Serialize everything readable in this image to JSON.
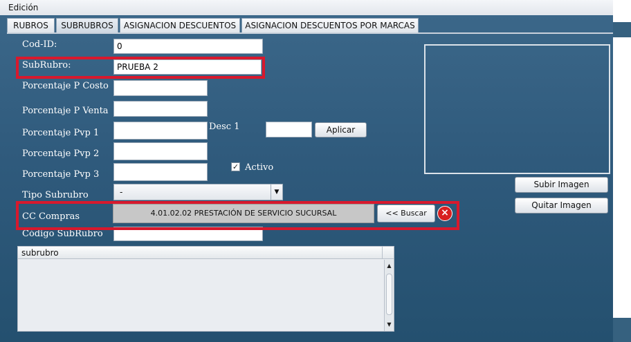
{
  "menu": {
    "edicion": "Edición"
  },
  "tabs": [
    {
      "label": "RUBROS"
    },
    {
      "label": "SUBRUBROS"
    },
    {
      "label": "ASIGNACION DESCUENTOS"
    },
    {
      "label": "ASIGNACION DESCUENTOS POR MARCAS"
    }
  ],
  "form": {
    "cod_id_label": "Cod-ID:",
    "cod_id_value": "0",
    "subrubro_label": "SubRubro:",
    "subrubro_value": "PRUEBA 2",
    "pct_costo_label": "Porcentaje P Costo",
    "pct_venta_label": "Porcentaje P Venta",
    "pct_pvp1_label": "Porcentaje Pvp 1",
    "pct_pvp2_label": "Porcentaje Pvp 2",
    "pct_pvp3_label": "Porcentaje Pvp 3",
    "desc1_label": "Desc 1",
    "aplicar_label": "Aplicar",
    "activo_label": "Activo",
    "activo_checked": true,
    "tipo_label": "Tipo Subrubro",
    "tipo_value": "-",
    "cc_label": "CC Compras",
    "cc_value": "4.01.02.02  PRESTACIÓN DE SERVICIO SUCURSAL",
    "buscar_label": "<< Buscar",
    "codigo_label": "Código SubRubro"
  },
  "image": {
    "subir_label": "Subir Imagen",
    "quitar_label": "Quitar Imagen"
  },
  "table": {
    "column": "subrubro"
  },
  "colors": {
    "highlight": "#d8192d",
    "panel_bg": "#2f5a7c"
  }
}
